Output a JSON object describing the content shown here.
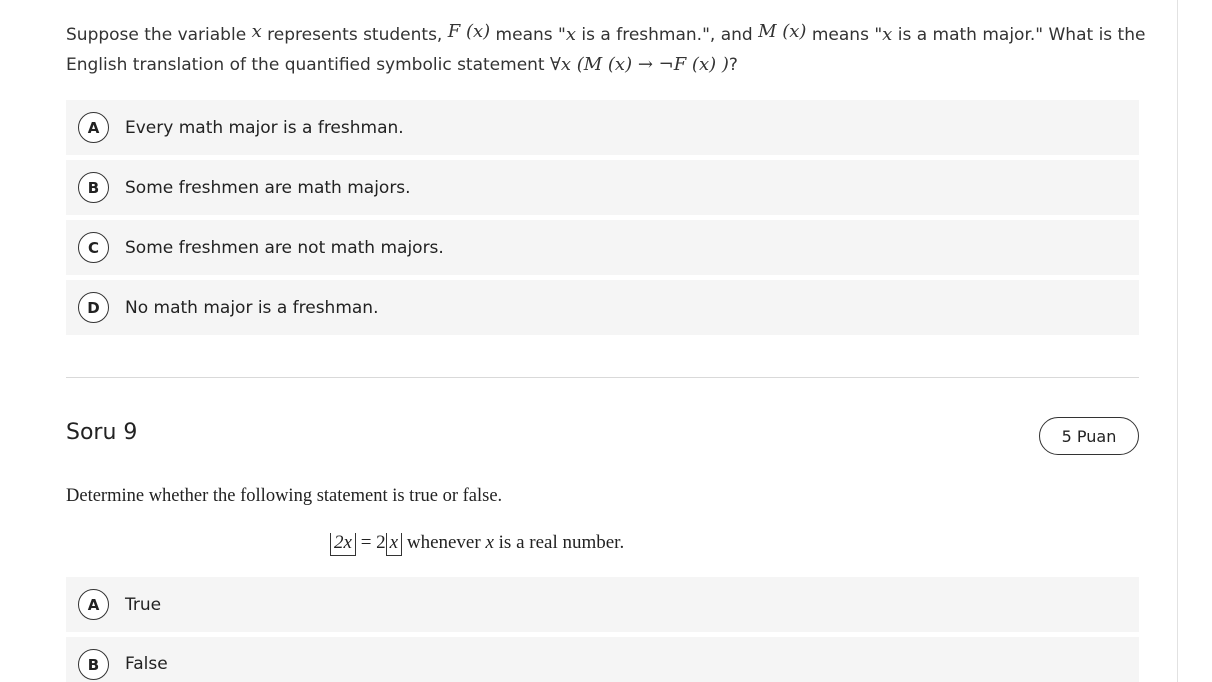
{
  "question8": {
    "stem_parts": {
      "p1": "Suppose the variable ",
      "var_x": "x",
      "p2": " represents students, ",
      "F_of_x": "F (x)",
      "p3": " means \"",
      "var_x2": "x",
      "p4": " is a freshman.\", and ",
      "M_of_x": "M (x)",
      "p5": " means \"",
      "var_x3": "x",
      "p6": " is a math major.\" What is the",
      "line2": "English translation of the quantified symbolic statement ",
      "formula": "∀x (M (x) → ¬F (x) )",
      "end": "?"
    },
    "options": [
      {
        "letter": "A",
        "text": "Every math major is a freshman."
      },
      {
        "letter": "B",
        "text": "Some freshmen are math majors."
      },
      {
        "letter": "C",
        "text": "Some freshmen are not math majors."
      },
      {
        "letter": "D",
        "text": "No math major is a freshman."
      }
    ]
  },
  "question9": {
    "title": "Soru 9",
    "points": "5 Puan",
    "prompt": "Determine whether the following statement is true or false.",
    "formula": {
      "lhs_inner": "2x",
      "equals": " = 2",
      "rhs_inner": "x",
      "tail_1": " whenever ",
      "tail_var": "x",
      "tail_2": " is a real number."
    },
    "options": [
      {
        "letter": "A",
        "text": "True"
      },
      {
        "letter": "B",
        "text": "False"
      }
    ]
  }
}
